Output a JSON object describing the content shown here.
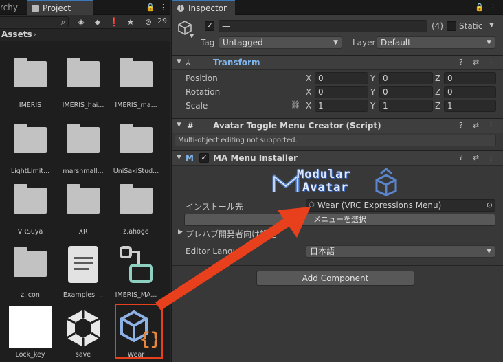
{
  "project_panel": {
    "tabs": [
      {
        "label": "rchy"
      },
      {
        "label": "Project"
      }
    ],
    "hidden_count": "29",
    "breadcrumb": "Assets",
    "assets": [
      {
        "label": "IMERIS",
        "type": "folder"
      },
      {
        "label": "IMERIS_hai...",
        "type": "folder"
      },
      {
        "label": "IMERIS_ma...",
        "type": "folder"
      },
      {
        "label": "LightLimit...",
        "type": "folder"
      },
      {
        "label": "marshmall...",
        "type": "folder"
      },
      {
        "label": "UniSakiStud...",
        "type": "folder"
      },
      {
        "label": "VRSuya",
        "type": "folder"
      },
      {
        "label": "XR",
        "type": "folder"
      },
      {
        "label": "z.ahoge",
        "type": "folder"
      },
      {
        "label": "z.icon",
        "type": "folder"
      },
      {
        "label": "Examples ...",
        "type": "document"
      },
      {
        "label": "IMERIS_MA...",
        "type": "prefab-variant"
      },
      {
        "label": "Lock_key",
        "type": "white-texture"
      },
      {
        "label": "save",
        "type": "unity-icon"
      },
      {
        "label": "Wear",
        "type": "expressions-menu"
      }
    ]
  },
  "inspector": {
    "tab_label": "Inspector",
    "gameobject": {
      "name": "—",
      "count": "(4)",
      "static_label": "Static",
      "tag_label": "Tag",
      "tag_value": "Untagged",
      "layer_label": "Layer",
      "layer_value": "Default"
    },
    "transform": {
      "title": "Transform",
      "rows": [
        {
          "label": "Position",
          "x": "0",
          "y": "0",
          "z": "0"
        },
        {
          "label": "Rotation",
          "x": "0",
          "y": "0",
          "z": "0"
        },
        {
          "label": "Scale",
          "x": "1",
          "y": "1",
          "z": "1"
        }
      ],
      "axis_x": "X",
      "axis_y": "Y",
      "axis_z": "Z"
    },
    "toggle_menu_creator": {
      "title": "Avatar Toggle Menu Creator (Script)",
      "message": "Multi-object editing not supported."
    },
    "ma_menu_installer": {
      "title": "MA Menu Installer",
      "logo_line1": "Modular",
      "logo_line2": "Avatar",
      "install_to_label": "インストール先",
      "install_to_value": "Wear (VRC Expressions Menu)",
      "select_menu_button": "メニューを選択",
      "prefab_dev_settings": "プレハブ開発者向け設定",
      "editor_language_label": "Editor Langua",
      "editor_language_value": "日本語"
    },
    "add_component": "Add Component"
  },
  "colors": {
    "accent_tab": "#3a79bb",
    "annotation_arrow": "#e8401c",
    "selection_box": "#e8401c"
  }
}
